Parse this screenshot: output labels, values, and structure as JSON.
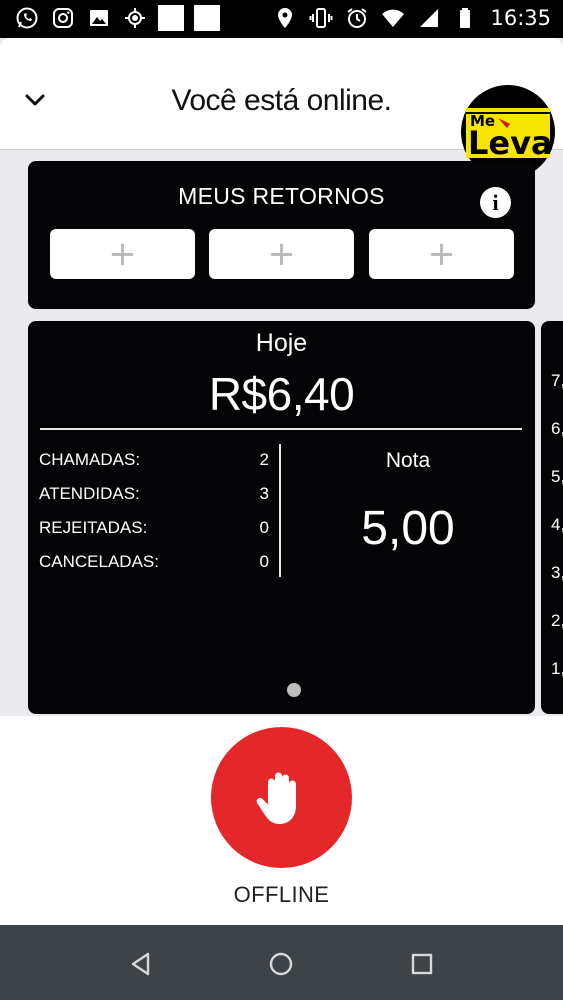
{
  "status_bar": {
    "time": "16:35",
    "left_icons": [
      "whatsapp-icon",
      "instagram-icon",
      "image-icon",
      "gps-icon",
      "blank-notification-icon",
      "blank-notification-icon"
    ],
    "right_icons": [
      "location-icon",
      "vibrate-icon",
      "alarm-icon",
      "wifi-icon",
      "signal-icon",
      "battery-icon"
    ]
  },
  "header": {
    "title": "Você está online.",
    "logo": {
      "text_top": "Me",
      "text_main": "Leva"
    }
  },
  "returns": {
    "title": "MEUS RETORNOS",
    "info_icon": "i",
    "slots": [
      "+",
      "+",
      "+"
    ]
  },
  "today": {
    "label": "Hoje",
    "value": "R$6,40",
    "stats": [
      {
        "label": "CHAMADAS:",
        "value": "2"
      },
      {
        "label": "ATENDIDAS:",
        "value": "3"
      },
      {
        "label": "REJEITADAS:",
        "value": "0"
      },
      {
        "label": "CANCELADAS:",
        "value": "0"
      }
    ],
    "rating_label": "Nota",
    "rating_value": "5,00"
  },
  "next_card_ticks": [
    "7,",
    "6,",
    "5,",
    "4,",
    "3,",
    "2,",
    "1,"
  ],
  "bottom": {
    "button_icon": "hand-stop-icon",
    "label": "OFFLINE"
  },
  "colors": {
    "accent_red": "#e4282a",
    "card_bg": "#040406",
    "logo_yellow": "#f7e400"
  }
}
